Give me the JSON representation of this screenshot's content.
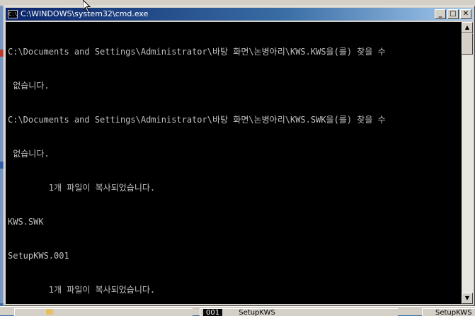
{
  "window": {
    "title": "C:\\WINDOWS\\system32\\cmd.exe",
    "icon_label": "C:\\",
    "buttons": {
      "minimize": "_",
      "maximize": "□",
      "close": "✕"
    }
  },
  "console": {
    "lines": [
      "C:\\Documents and Settings\\Administrator\\바탕 화면\\논병아리\\KWS.KWS을(를) 찾을 수",
      " 없습니다.",
      "C:\\Documents and Settings\\Administrator\\바탕 화면\\논병아리\\KWS.SWK을(를) 찾을 수",
      " 없습니다.",
      "        1개 파일이 복사되었습니다.",
      "KWS.SWK",
      "SetupKWS.001",
      "        1개 파일이 복사되었습니다."
    ]
  },
  "scrollbar": {
    "up_glyph": "▲",
    "down_glyph": "▼"
  },
  "taskbar": {
    "items": [
      {
        "number": "001",
        "label": "SetupKWS"
      },
      {
        "label": "SetupKWS"
      }
    ]
  },
  "colors": {
    "console_bg": "#000000",
    "console_text": "#c0c0c0",
    "title_start": "#0a246a",
    "title_end": "#a6caf0"
  }
}
